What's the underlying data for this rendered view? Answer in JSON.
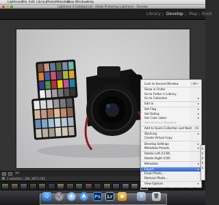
{
  "menubar": {
    "items": [
      "Lightroom",
      "File",
      "Edit",
      "Library",
      "Photo",
      "Metadata",
      "View",
      "Window",
      "Help"
    ]
  },
  "window": {
    "title": "Lightroom 4 Catalog.lrcat - Adobe Photoshop Lightroom - Develop"
  },
  "modules": {
    "library": "Library",
    "develop": "Develop",
    "map": "Map",
    "book": "Book",
    "separator": "|"
  },
  "filmstrip": {
    "breadcrumb": "1 selected / _DSL_0671.CR2"
  },
  "context_menu": {
    "items": [
      {
        "label": "Lock to Second Window",
        "shortcut": "⇧⌘↩",
        "enabled": true
      },
      {
        "label": "Show in Finder",
        "enabled": true
      },
      {
        "label": "Go to Folder in Library",
        "enabled": true
      },
      {
        "label": "Go to Collection",
        "submenu": true,
        "enabled": true
      },
      {
        "label": "Edit In",
        "submenu": true,
        "enabled": true
      },
      {
        "label": "Set Flag",
        "submenu": true,
        "enabled": true
      },
      {
        "label": "Set Rating",
        "submenu": true,
        "enabled": true
      },
      {
        "label": "Set Color Label",
        "submenu": true,
        "enabled": true
      },
      {
        "label": "Add Shortcut Keyword",
        "enabled": false
      },
      {
        "label": "Add to Quick Collection and Next",
        "shortcut": "⇧B",
        "enabled": true
      },
      {
        "label": "Stacking",
        "submenu": true,
        "enabled": true
      },
      {
        "label": "Create Virtual Copy",
        "enabled": true
      },
      {
        "label": "Develop Settings",
        "submenu": true,
        "enabled": true
      },
      {
        "label": "Metadata Presets",
        "submenu": true,
        "enabled": true
      },
      {
        "label": "Rotate Left (CCW)",
        "enabled": true
      },
      {
        "label": "Rotate Right (CW)",
        "enabled": true
      },
      {
        "label": "Metadata",
        "submenu": true,
        "enabled": true
      },
      {
        "label": "Export",
        "submenu": true,
        "enabled": true,
        "highlighted": true
      },
      {
        "label": "Email Photo...",
        "enabled": true
      },
      {
        "label": "Remove Photo...",
        "enabled": true
      },
      {
        "label": "View Options",
        "submenu": true,
        "enabled": true
      }
    ]
  },
  "colors": {
    "highlight": "#3a6fdc",
    "active_module": "#e6e6e6",
    "inactive_module": "#8a8a8a"
  },
  "dock": {
    "icons": [
      "finder-icon",
      "launchpad-icon",
      "safari-icon",
      "app-store-icon",
      "photoshop-icon",
      "lightroom-icon",
      "bridge-icon",
      "downloads-icon",
      "trash-icon"
    ],
    "ps_label": "Ps",
    "lr_label": "Lr"
  }
}
